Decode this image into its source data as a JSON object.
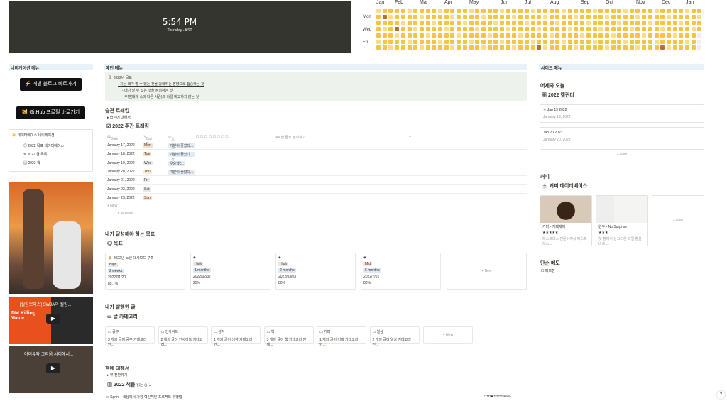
{
  "clock": {
    "time": "5:54 PM",
    "sub": "Thursday - KST"
  },
  "heatmap": {
    "months": [
      "Jan",
      "Feb",
      "Mar",
      "Apr",
      "May",
      "Jun",
      "Jul",
      "Aug",
      "Sep",
      "Oct",
      "Nov",
      "Dec",
      "Jan"
    ],
    "days": [
      "Mon",
      "Wed",
      "Fri"
    ],
    "colors": {
      "base": "#f5c542",
      "light": "#f9dd8a",
      "dark": "#b5712a",
      "empty": "#eeeeee"
    }
  },
  "left": {
    "header": "네비게이션 메뉴",
    "blog_button": "⚡ 개발 블로그 바로가기",
    "github_button": "🐱 GitHub 프로필 바로가기",
    "db_title": "데이터베이스 네비게이션",
    "db_links": [
      "2022 목표 데이터베이스",
      "2022 글 목록",
      "2022 책"
    ],
    "video1_title": "[킬링보이스] SWJA의 킬링...",
    "video1_logo": "DM Killing Voice",
    "video2_title": "아이유와 그리움 사이에서..."
  },
  "main": {
    "header": "메인 메뉴",
    "callout_title": "2022년 목표",
    "callout_lines": [
      "지금 내가 할 수 있는 것을 강화하는 방향으로 집중하는 것",
      "내가 할 수 있는 것을 정의하는 것",
      "주변(매체 속의 다른 사람)과 나를 비교하지 않는 것"
    ],
    "habit_title": "습관 트래킹",
    "habit_toggle": "습관에 대해서",
    "tracker_title": "2022 주간 트래킹",
    "tracker_headers": [
      "Date",
      "Day of t...",
      "오늘의 감정",
      "Aa 한 줄로 정리하기"
    ],
    "tracker_rows": [
      {
        "date": "January 17, 2022",
        "day": "Mon",
        "mood": "기분이 좋았다..."
      },
      {
        "date": "January 18, 2022",
        "day": "Tue",
        "mood": "기분이 좋았다..."
      },
      {
        "date": "January 19, 2022",
        "day": "Wed",
        "mood": "우울했다."
      },
      {
        "date": "January 20, 2022",
        "day": "Thu",
        "mood": "기분이 좋았다..."
      },
      {
        "date": "January 21, 2022",
        "day": "Fri",
        "mood": ""
      },
      {
        "date": "January 22, 2022",
        "day": "Sat",
        "mood": ""
      },
      {
        "date": "January 23, 2022",
        "day": "Sun",
        "mood": ""
      }
    ],
    "new_label": "+ New",
    "calculate": "Calculate ⌄",
    "goals_title": "내가 달성해야 하는 목표",
    "goals_db": "목표",
    "goals": [
      {
        "title": "2022년 노션 대시보드 구축",
        "priority": "High",
        "duration": "2 weeks",
        "date": "2022/01/20",
        "pct": "85.7%"
      },
      {
        "title": "",
        "priority": "High",
        "duration": "1 months",
        "date": "2022/02/07",
        "pct": "25%"
      },
      {
        "title": "",
        "priority": "High",
        "duration": "2 months",
        "date": "2022/03/03",
        "pct": "80%"
      },
      {
        "title": "",
        "priority": "Mid",
        "duration": "6 months",
        "date": "2022/7/01",
        "pct": "80%"
      }
    ],
    "posts_title": "내가 발행한 글",
    "posts_db": "글 카테고리",
    "categories": [
      {
        "name": "공부",
        "desc": "3 개의 글이 공부 카테고리 안..."
      },
      {
        "name": "인사이트",
        "desc": "2 개의 글이 인사이트 카테고리..."
      },
      {
        "name": "생각",
        "desc": "1 개의 글이 생각 카테고리 안..."
      },
      {
        "name": "책",
        "desc": "3 개의 글이 책 카테고리 안에..."
      },
      {
        "name": "커피",
        "desc": "1 개의 글이 커피 카테고리 안..."
      },
      {
        "name": "일상",
        "desc": "2 개의 글이 일상 카테고리 안..."
      }
    ],
    "books_title": "책에 대해서",
    "books_toggle": "뷰 전환하기",
    "books_db": "2022 책들",
    "books_filter": "읽는 중 ⌄",
    "book_row": "Sprint - 세상에서 가장 혁신적인 프로젝트 수행법",
    "book_progress": "46%"
  },
  "right": {
    "header": "사이드 메뉴",
    "cal_title": "어제와 오늘",
    "cal_db": "2022 캘린더",
    "cal_items": [
      {
        "title": "Jan 19 2022",
        "date": "January 19, 2022"
      },
      {
        "title": "Jan 20 2022",
        "date": "January 20, 2022"
      }
    ],
    "coffee_title": "커피",
    "coffee_db": "커피 데이터베이스",
    "coffees": [
      {
        "name": "커피 - 카페제제",
        "stars": "★★★★★",
        "desc": "에스프레스 전문이여서 에스프레스..."
      },
      {
        "name": "원두 - No Surprise",
        "stars": "★★★",
        "desc": "첫 향에서 상그러운 과일 향을 바로 ..."
      }
    ],
    "memo_title": "단순 메모",
    "memo_item": "메모장"
  },
  "help": "?"
}
